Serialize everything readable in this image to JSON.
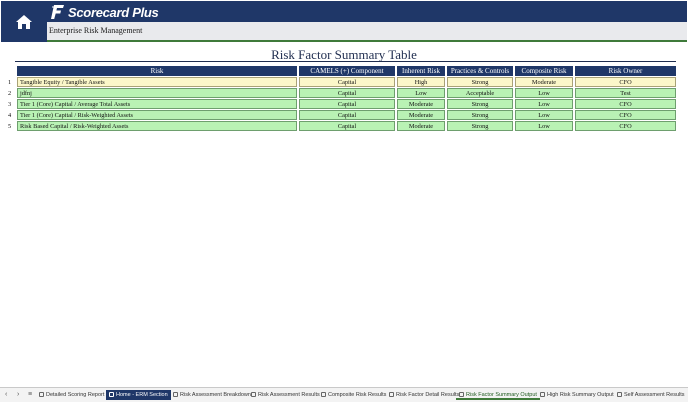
{
  "app": {
    "logo_text": "Scorecard Plus",
    "section": "Enterprise Risk Management"
  },
  "page": {
    "title": "Risk Factor Summary Table"
  },
  "table": {
    "headers": [
      "Risk",
      "CAMELS (+) Component",
      "Inherent Risk",
      "Practices & Controls",
      "Composite Risk",
      "Risk Owner"
    ],
    "rows": [
      {
        "num": "1",
        "risk": "Tangible Equity / Tangible Assets",
        "camels": "Capital",
        "inherent": "High",
        "practices": "Strong",
        "composite": "Moderate",
        "owner": "CFO",
        "highlight": true
      },
      {
        "num": "2",
        "risk": "jdfnj",
        "camels": "Capital",
        "inherent": "Low",
        "practices": "Acceptable",
        "composite": "Low",
        "owner": "Test",
        "highlight": false
      },
      {
        "num": "3",
        "risk": "Tier 1 (Core) Capital / Average Total Assets",
        "camels": "Capital",
        "inherent": "Moderate",
        "practices": "Strong",
        "composite": "Low",
        "owner": "CFO",
        "highlight": false
      },
      {
        "num": "4",
        "risk": "Tier 1 (Core) Capital / Risk-Weighted Assets",
        "camels": "Capital",
        "inherent": "Moderate",
        "practices": "Strong",
        "composite": "Low",
        "owner": "CFO",
        "highlight": false
      },
      {
        "num": "5",
        "risk": "Risk Based Capital / Risk-Weighted Assets",
        "camels": "Capital",
        "inherent": "Moderate",
        "practices": "Strong",
        "composite": "Low",
        "owner": "CFO",
        "highlight": false
      }
    ]
  },
  "tabs": {
    "nav": [
      "‹",
      "›",
      "≡"
    ],
    "items": [
      {
        "label": "Detailed Scoring Report",
        "state": "normal"
      },
      {
        "label": "Home - ERM Section",
        "state": "active-blue"
      },
      {
        "label": "Risk Assessment Breakdown",
        "state": "normal"
      },
      {
        "label": "Risk Assessment Results",
        "state": "normal"
      },
      {
        "label": "Composite Risk Results",
        "state": "normal"
      },
      {
        "label": "Risk Factor Detail Results",
        "state": "normal"
      },
      {
        "label": "Risk Factor Summary Output",
        "state": "selected"
      },
      {
        "label": "High Risk Summary Output",
        "state": "normal"
      },
      {
        "label": "Self Assessment Results",
        "state": "normal"
      }
    ]
  },
  "colors": {
    "brand_navy": "#1f3768",
    "cell_green": "#b9f2b4",
    "cell_highlight": "#fbf7c9",
    "accent_green": "#3f7a3a"
  },
  "icons": {
    "home": "home-icon",
    "logo": "scorecard-logo-icon",
    "tab": "sheet-tab-icon"
  }
}
